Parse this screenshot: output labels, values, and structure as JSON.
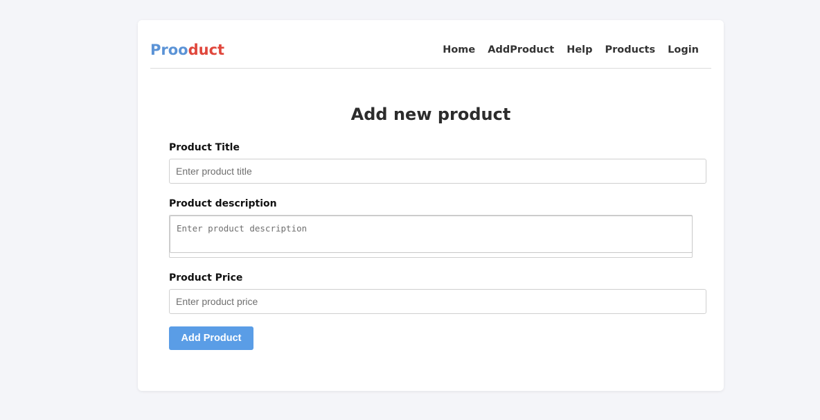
{
  "brand": {
    "part1": "Proo",
    "part2": "duct",
    "color1": "#5b93d6",
    "color2": "#e0473c"
  },
  "nav": {
    "items": [
      {
        "label": "Home"
      },
      {
        "label": "AddProduct"
      },
      {
        "label": "Help"
      },
      {
        "label": "Products"
      },
      {
        "label": "Login"
      }
    ]
  },
  "page": {
    "title": "Add new product"
  },
  "form": {
    "title_label": "Product Title",
    "title_value": "",
    "title_placeholder": "Enter product title",
    "description_label": "Product description",
    "description_value": "",
    "description_placeholder": "Enter product description",
    "price_label": "Product Price",
    "price_value": "",
    "price_placeholder": "Enter product price",
    "submit_label": "Add Product"
  },
  "colors": {
    "accent": "#5a9de6",
    "background": "#f4f5f9"
  }
}
